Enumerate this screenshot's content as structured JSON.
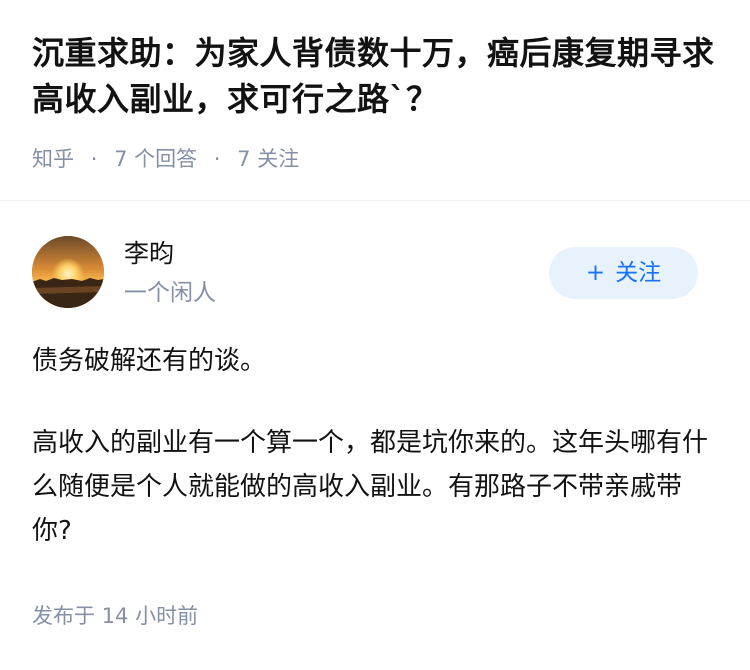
{
  "question": {
    "title": "沉重求助：为家人背债数十万，癌后康复期寻求高收入副业，求可行之路`？",
    "source": "知乎",
    "separator": "·",
    "answers_label": "7 个回答",
    "followers_label": "7 关注"
  },
  "answer": {
    "author": {
      "name": "李昀",
      "headline": "一个闲人",
      "avatar_icon": "sunset-avatar"
    },
    "follow_button": {
      "plus": "+",
      "label": "关注"
    },
    "paragraphs": [
      "债务破解还有的谈。",
      "高收入的副业有一个算一个，都是坑你来的。这年头哪有什么随便是个人就能做的高收入副业。有那路子不带亲戚带你?"
    ],
    "published_label": "发布于",
    "published_time": "14 小时前"
  },
  "colors": {
    "text": "#121212",
    "muted": "#8590a6",
    "brand_blue": "#1772f6",
    "follow_bg": "#e8f2fc"
  }
}
